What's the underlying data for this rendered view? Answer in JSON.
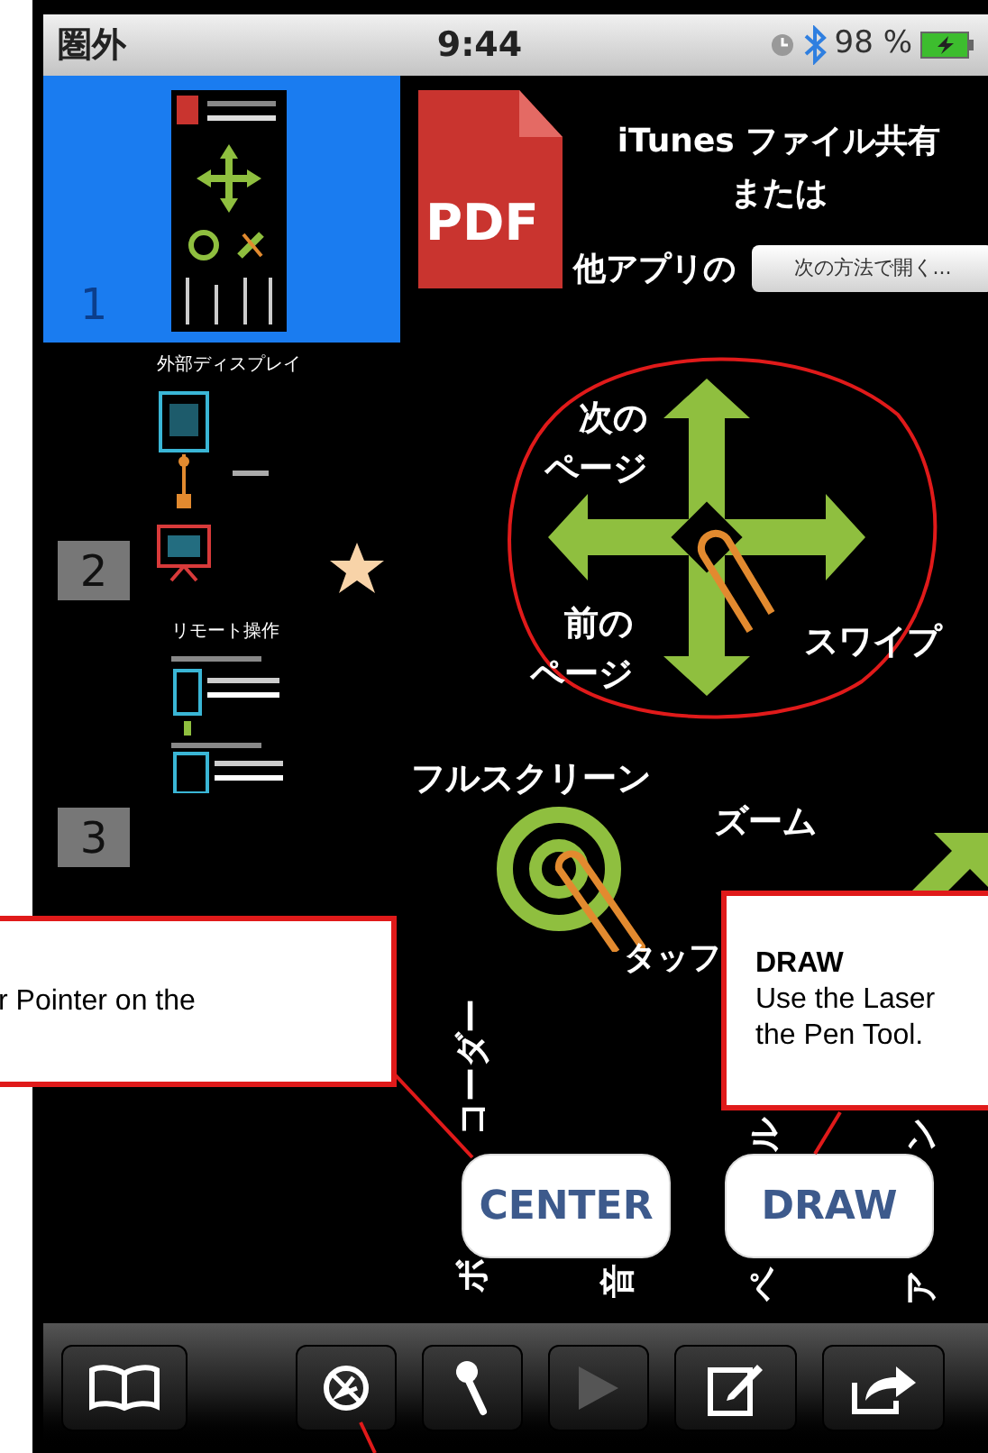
{
  "status_bar": {
    "carrier": "圏外",
    "time": "9:44",
    "battery": "98 %",
    "bluetooth": true
  },
  "sidebar": {
    "pages": [
      {
        "number": "1",
        "selected": true,
        "starred": false,
        "kind": "cover"
      },
      {
        "number": "2",
        "selected": false,
        "starred": true,
        "kind": "display",
        "caption": "外部ディスプレイ"
      },
      {
        "number": "3",
        "selected": false,
        "starred": false,
        "kind": "remote",
        "caption": "リモート操作"
      }
    ]
  },
  "slide": {
    "pdf_label": "PDF",
    "heading_lines": [
      "iTunes ファイル共有",
      "または"
    ],
    "open_with_prefix": "他アプリの",
    "open_with_button": "次の方法で開く...",
    "next_page": [
      "次の",
      "ページ"
    ],
    "prev_page": [
      "前の",
      "ページ"
    ],
    "swipe": "スワイプ",
    "fullscreen": "フルスクリーン",
    "zoom": "ズーム",
    "tap": "タッフ",
    "vertical_labels": [
      {
        "text": "コーダー"
      },
      {
        "text": "ボ"
      },
      {
        "text": "音"
      },
      {
        "text": "ル"
      },
      {
        "text": "ペ"
      },
      {
        "text": "ン"
      },
      {
        "text": "ア"
      }
    ]
  },
  "buttons": [
    {
      "label": "CENTER"
    },
    {
      "label": "DRAW"
    }
  ],
  "toolbar": [
    {
      "kind": "book",
      "disabled": false
    },
    {
      "kind": "compass",
      "disabled": false
    },
    {
      "kind": "mic",
      "disabled": false
    },
    {
      "kind": "play",
      "disabled": true
    },
    {
      "kind": "compose",
      "disabled": false
    },
    {
      "kind": "share",
      "disabled": false
    }
  ],
  "callouts": [
    {
      "lines": [
        "r Pointer on the"
      ]
    },
    {
      "title": "DRAW",
      "lines": [
        "Use the Laser",
        "the Pen Tool."
      ]
    }
  ]
}
